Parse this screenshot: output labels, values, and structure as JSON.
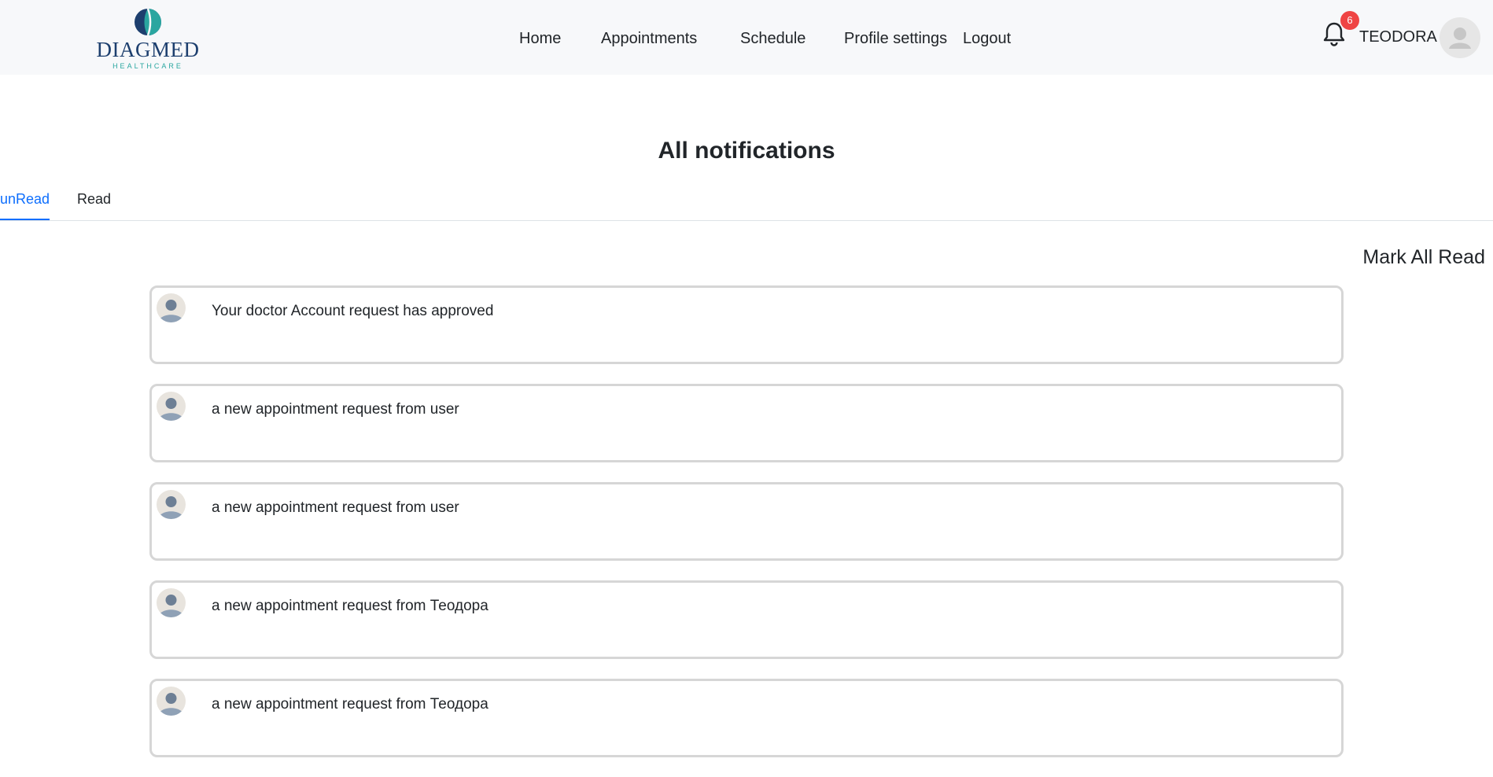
{
  "header": {
    "logo": {
      "name": "DIAGMED",
      "tagline": "HEALTHCARE"
    },
    "nav": {
      "home": "Home",
      "appointments": "Appointments",
      "schedule": "Schedule",
      "profile_settings": "Profile settings",
      "logout": "Logout"
    },
    "notifications_icon": "bell-icon",
    "notification_count": "6",
    "username": "TEODORA",
    "avatar_icon": "user-avatar-icon"
  },
  "main": {
    "title": "All notifications",
    "tabs": {
      "unread": "unRead",
      "read": "Read",
      "active": "unread"
    },
    "mark_all_read": "Mark All Read",
    "notifications": [
      {
        "text": "Your doctor Account request has approved"
      },
      {
        "text": "a new appointment request from user"
      },
      {
        "text": "a new appointment request from user"
      },
      {
        "text": "a new appointment request from Теодора"
      },
      {
        "text": "a new appointment request from Теодора"
      }
    ]
  },
  "colors": {
    "accent": "#0d6efd",
    "badge": "#ef4444",
    "navbar_bg": "#f7f8fa",
    "card_border": "#d6d6d6",
    "logo_navy": "#1d3f6e",
    "logo_teal": "#2aa6a0"
  }
}
